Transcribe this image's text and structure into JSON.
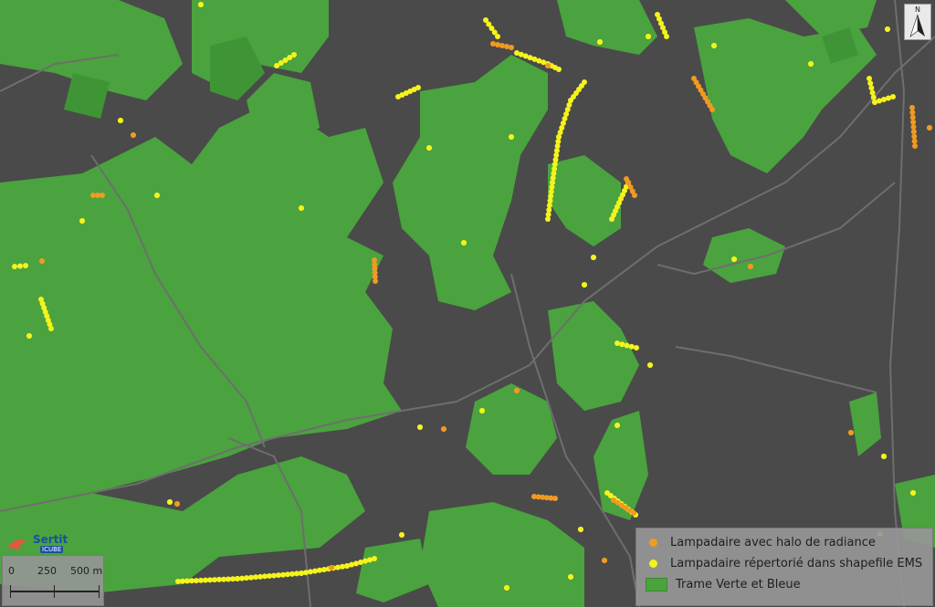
{
  "legend": {
    "items": [
      {
        "label": "Lampadaire avec halo de radiance",
        "color": "#f09a22",
        "symbol": "dot"
      },
      {
        "label": "Lampadaire répertorié dans shapefile EMS",
        "color": "#f4f41c",
        "symbol": "dot"
      },
      {
        "label": "Trame Verte et Bleue",
        "color": "#4aa33e",
        "symbol": "rect"
      }
    ]
  },
  "scale": {
    "labels": [
      "0",
      "250",
      "500 m"
    ]
  },
  "logo": {
    "name": "Sertit",
    "sub": "ICUBE"
  },
  "north": {
    "label": "N"
  },
  "colors": {
    "urban": "#4a4a4a",
    "green": "#4aa33e",
    "green_dark": "#3f9536",
    "road": "#6e6e6e",
    "orange": "#f09a22",
    "yellow": "#f4f41c"
  }
}
